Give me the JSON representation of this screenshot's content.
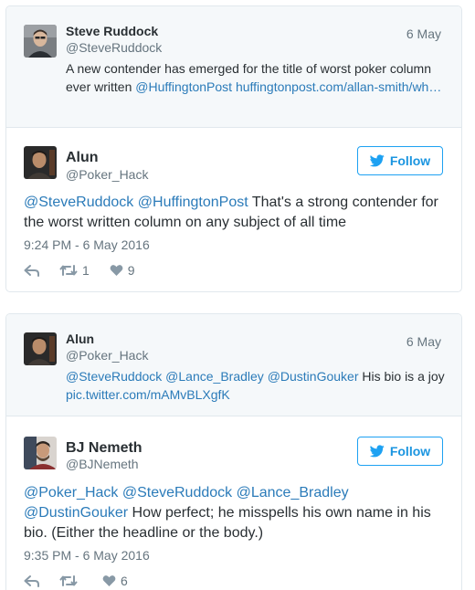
{
  "tweets": [
    {
      "quoted": {
        "name": "Steve Ruddock",
        "handle": "@SteveRuddock",
        "date": "6 May",
        "text_parts": [
          {
            "t": "A new contender has emerged for the title of worst poker column ever written ",
            "link": false
          },
          {
            "t": "@HuffingtonPost",
            "link": true
          },
          {
            "t": " ",
            "link": false
          },
          {
            "t": "huffingtonpost.com/allan-smith/wh…",
            "link": true
          }
        ]
      },
      "main": {
        "name": "Alun",
        "handle": "@Poker_Hack",
        "follow_label": "Follow",
        "text_parts": [
          {
            "t": "@SteveRuddock",
            "link": true
          },
          {
            "t": " ",
            "link": false
          },
          {
            "t": "@HuffingtonPost",
            "link": true
          },
          {
            "t": " That's a strong contender for the worst written column on any subject of all time",
            "link": false
          }
        ],
        "time": "9:24 PM - 6 May 2016",
        "retweets": "1",
        "likes": "9"
      }
    },
    {
      "quoted": {
        "name": "Alun",
        "handle": "@Poker_Hack",
        "date": "6 May",
        "text_parts": [
          {
            "t": "@SteveRuddock",
            "link": true
          },
          {
            "t": " ",
            "link": false
          },
          {
            "t": "@Lance_Bradley",
            "link": true
          },
          {
            "t": " ",
            "link": false
          },
          {
            "t": "@DustinGouker",
            "link": true
          },
          {
            "t": " His bio is a joy ",
            "link": false
          },
          {
            "t": "pic.twitter.com/mAMvBLXgfK",
            "link": true
          }
        ]
      },
      "main": {
        "name": "BJ Nemeth",
        "handle": "@BJNemeth",
        "follow_label": "Follow",
        "text_parts": [
          {
            "t": "@Poker_Hack",
            "link": true
          },
          {
            "t": " ",
            "link": false
          },
          {
            "t": "@SteveRuddock",
            "link": true
          },
          {
            "t": " ",
            "link": false
          },
          {
            "t": "@Lance_Bradley",
            "link": true
          },
          {
            "t": " ",
            "link": false
          },
          {
            "t": "@DustinGouker",
            "link": true
          },
          {
            "t": " How perfect; he misspells his own name in his bio. (Either the headline or the body.)",
            "link": false
          }
        ],
        "time": "9:35 PM - 6 May 2016",
        "retweets": "",
        "likes": "6"
      }
    }
  ],
  "colors": {
    "link": "#2b7bb9",
    "follow": "#1da1f2",
    "muted": "#66757f",
    "quoted_bg": "#f5f8fa",
    "border": "#e1e8ed"
  }
}
